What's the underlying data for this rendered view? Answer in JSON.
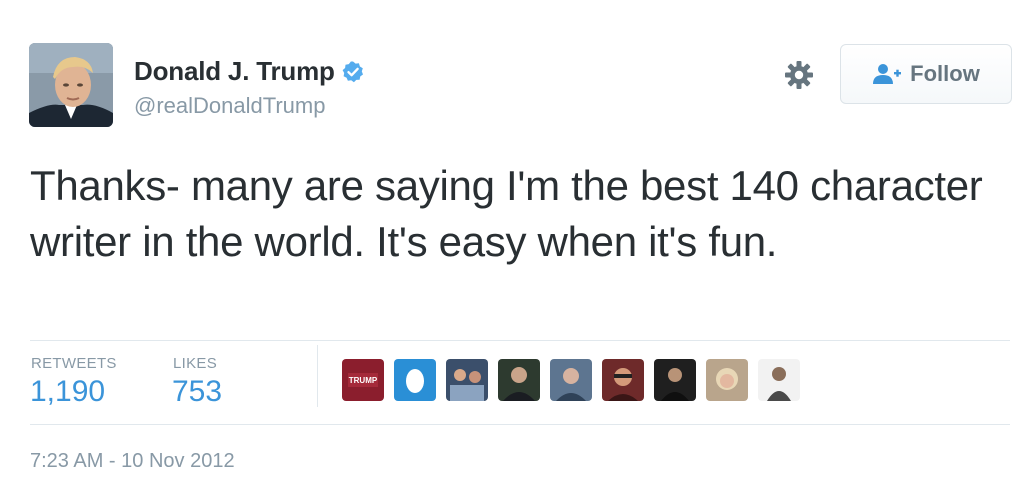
{
  "author": {
    "display_name": "Donald J. Trump",
    "handle": "@realDonaldTrump",
    "verified": true,
    "avatar_icon": "profile-photo"
  },
  "actions": {
    "settings_icon": "gear-icon",
    "follow_label": "Follow",
    "follow_icon": "person-plus-icon"
  },
  "tweet": {
    "text": "Thanks- many are saying I'm the best 140 character writer in the world. It's easy when it's fun."
  },
  "stats": {
    "retweets_label": "RETWEETS",
    "retweets_value": "1,190",
    "likes_label": "LIKES",
    "likes_value": "753"
  },
  "likers": [
    {
      "name": "liker-avatar-1",
      "text": "TRUMP"
    },
    {
      "name": "liker-avatar-2",
      "text": ""
    },
    {
      "name": "liker-avatar-3",
      "text": ""
    },
    {
      "name": "liker-avatar-4",
      "text": ""
    },
    {
      "name": "liker-avatar-5",
      "text": ""
    },
    {
      "name": "liker-avatar-6",
      "text": ""
    },
    {
      "name": "liker-avatar-7",
      "text": ""
    },
    {
      "name": "liker-avatar-8",
      "text": ""
    },
    {
      "name": "liker-avatar-9",
      "text": ""
    }
  ],
  "timestamp": "7:23 AM - 10 Nov 2012",
  "colors": {
    "link": "#3b94d9",
    "verified": "#55acee",
    "muted": "#8899a6",
    "text": "#292f33"
  }
}
